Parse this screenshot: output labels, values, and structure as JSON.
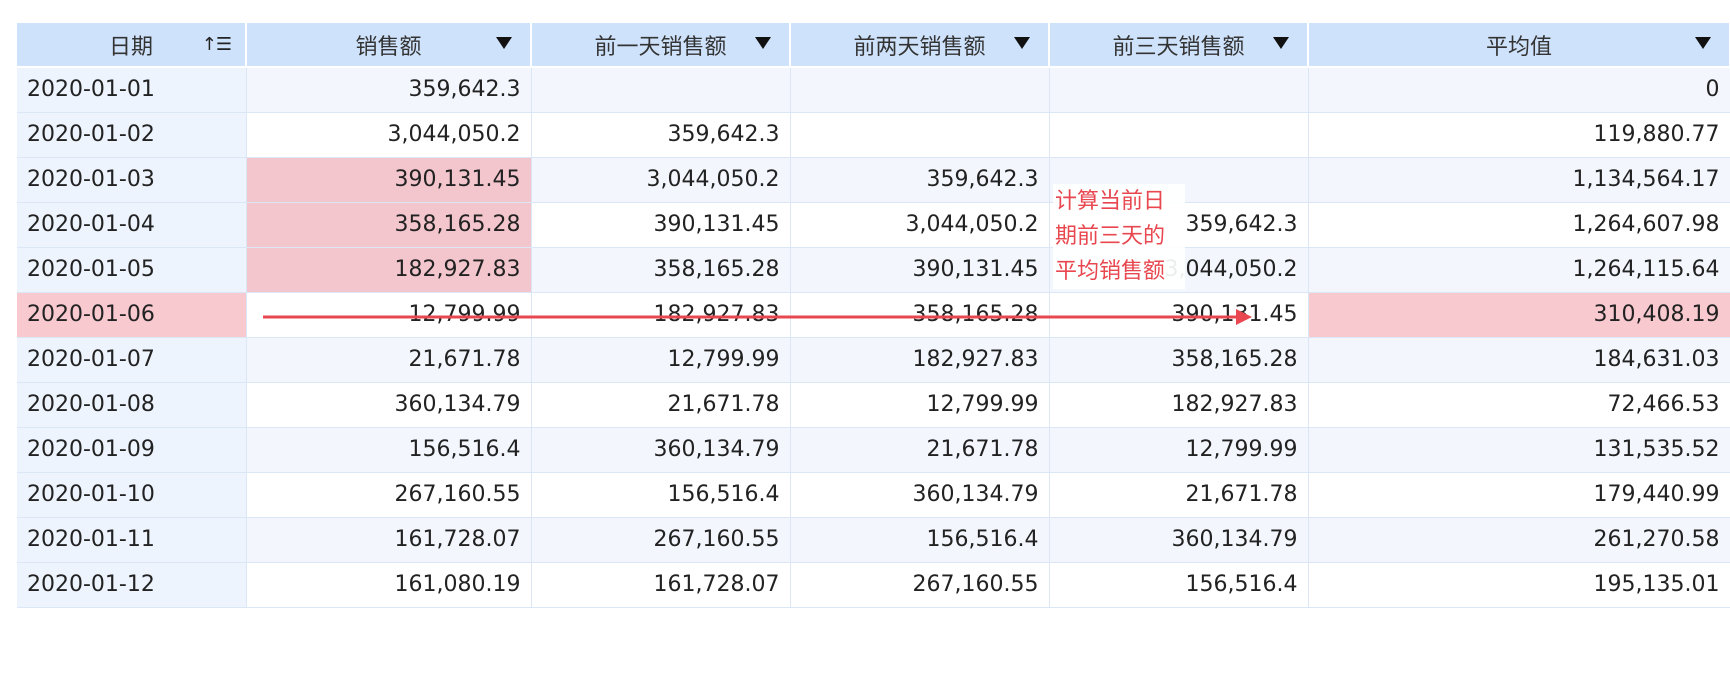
{
  "headers": [
    {
      "label": "日期",
      "icon": "sort-icon",
      "icon_text": "↑☰"
    },
    {
      "label": "销售额",
      "icon": "filter-dropdown-icon"
    },
    {
      "label": "前一天销售额",
      "icon": "filter-dropdown-icon"
    },
    {
      "label": "前两天销售额",
      "icon": "filter-dropdown-icon"
    },
    {
      "label": "前三天销售额",
      "icon": "filter-dropdown-icon"
    },
    {
      "label": "平均值",
      "icon": "filter-dropdown-icon"
    }
  ],
  "rows": [
    {
      "date": "2020-01-01",
      "sales": "359,642.3",
      "prev1": "",
      "prev2": "",
      "prev3": "",
      "avg": "0"
    },
    {
      "date": "2020-01-02",
      "sales": "3,044,050.2",
      "prev1": "359,642.3",
      "prev2": "",
      "prev3": "",
      "avg": "119,880.77"
    },
    {
      "date": "2020-01-03",
      "sales": "390,131.45",
      "prev1": "3,044,050.2",
      "prev2": "359,642.3",
      "prev3": "",
      "avg": "1,134,564.17"
    },
    {
      "date": "2020-01-04",
      "sales": "358,165.28",
      "prev1": "390,131.45",
      "prev2": "3,044,050.2",
      "prev3": "359,642.3",
      "avg": "1,264,607.98"
    },
    {
      "date": "2020-01-05",
      "sales": "182,927.83",
      "prev1": "358,165.28",
      "prev2": "390,131.45",
      "prev3": "3,044,050.2",
      "avg": "1,264,115.64"
    },
    {
      "date": "2020-01-06",
      "sales": "12,799.99",
      "prev1": "182,927.83",
      "prev2": "358,165.28",
      "prev3": "390,131.45",
      "avg": "310,408.19"
    },
    {
      "date": "2020-01-07",
      "sales": "21,671.78",
      "prev1": "12,799.99",
      "prev2": "182,927.83",
      "prev3": "358,165.28",
      "avg": "184,631.03"
    },
    {
      "date": "2020-01-08",
      "sales": "360,134.79",
      "prev1": "21,671.78",
      "prev2": "12,799.99",
      "prev3": "182,927.83",
      "avg": "72,466.53"
    },
    {
      "date": "2020-01-09",
      "sales": "156,516.4",
      "prev1": "360,134.79",
      "prev2": "21,671.78",
      "prev3": "12,799.99",
      "avg": "131,535.52"
    },
    {
      "date": "2020-01-10",
      "sales": "267,160.55",
      "prev1": "156,516.4",
      "prev2": "360,134.79",
      "prev3": "21,671.78",
      "avg": "179,440.99"
    },
    {
      "date": "2020-01-11",
      "sales": "161,728.07",
      "prev1": "267,160.55",
      "prev2": "156,516.4",
      "prev3": "360,134.79",
      "avg": "261,270.58"
    },
    {
      "date": "2020-01-12",
      "sales": "161,080.19",
      "prev1": "161,728.07",
      "prev2": "267,160.55",
      "prev3": "156,516.4",
      "avg": "195,135.01"
    }
  ],
  "annotation": {
    "text": "计算当前日期前三天的平均销售额",
    "color": "#e8474f"
  },
  "colors": {
    "header_bg": "#cfe2fb",
    "highlight": "#f3c6cd",
    "arrow": "#e8474f"
  }
}
